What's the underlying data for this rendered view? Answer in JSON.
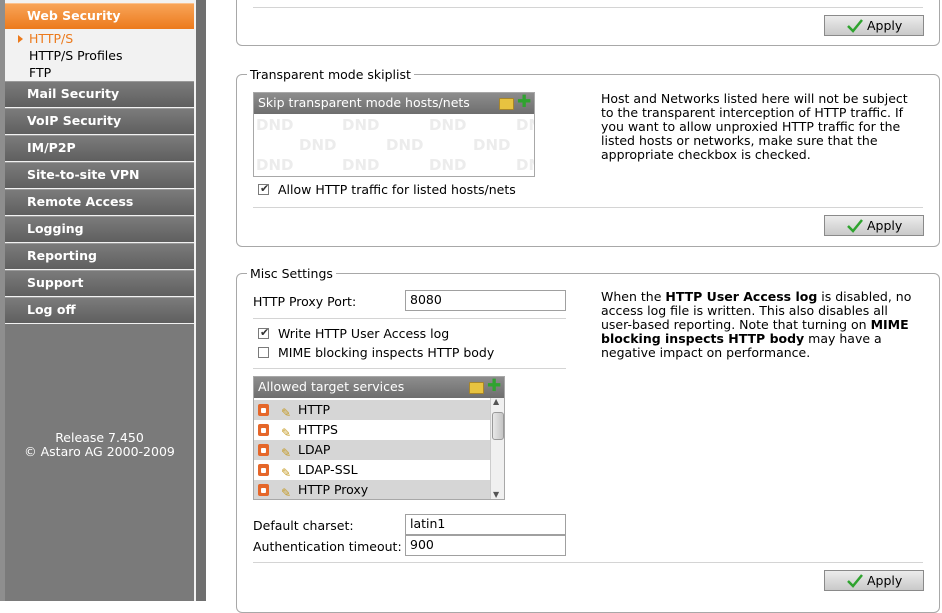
{
  "nav": {
    "active_label": "Web Security",
    "sub_items": [
      "HTTP/S",
      "HTTP/S Profiles",
      "FTP"
    ],
    "items": [
      "Mail Security",
      "VoIP Security",
      "IM/P2P",
      "Site-to-site VPN",
      "Remote Access",
      "Logging",
      "Reporting",
      "Support",
      "Log off"
    ],
    "release": "Release 7.450",
    "copyright": "© Astaro AG 2000-2009"
  },
  "top_box": {
    "apply_label": "Apply"
  },
  "skiplist": {
    "legend": "Transparent mode skiplist",
    "list_title": "Skip transparent mode hosts/nets",
    "dnd_label": "DND",
    "allow_label": "Allow HTTP traffic for listed hosts/nets",
    "allow_checked": true,
    "description": "Host and Networks listed here will not be subject to the transparent interception of HTTP traffic. If you want to allow unproxied HTTP traffic for the listed hosts or networks, make sure that the appropriate checkbox is checked.",
    "apply_label": "Apply"
  },
  "misc": {
    "legend": "Misc Settings",
    "proxy_port_label": "HTTP Proxy Port:",
    "proxy_port_value": "8080",
    "write_log_label": "Write HTTP User Access log",
    "write_log_checked": true,
    "mime_label": "MIME blocking inspects HTTP body",
    "mime_checked": false,
    "desc_part1": "When the ",
    "desc_bold1": "HTTP User Access log",
    "desc_part2": " is disabled, no access log file is written. This also disables all user-based reporting. Note that turning on ",
    "desc_bold2": "MIME blocking inspects HTTP body",
    "desc_part3": " may have a negative impact on performance.",
    "services_title": "Allowed target services",
    "services": [
      "HTTP",
      "HTTPS",
      "LDAP",
      "LDAP-SSL",
      "HTTP Proxy"
    ],
    "charset_label": "Default charset:",
    "charset_value": "latin1",
    "auth_timeout_label": "Authentication timeout:",
    "auth_timeout_value": "900",
    "apply_label": "Apply"
  },
  "colors": {
    "accent": "#ec7a1c",
    "nav_gray": "#6e6e6e",
    "apply_check": "#2fa32f"
  }
}
